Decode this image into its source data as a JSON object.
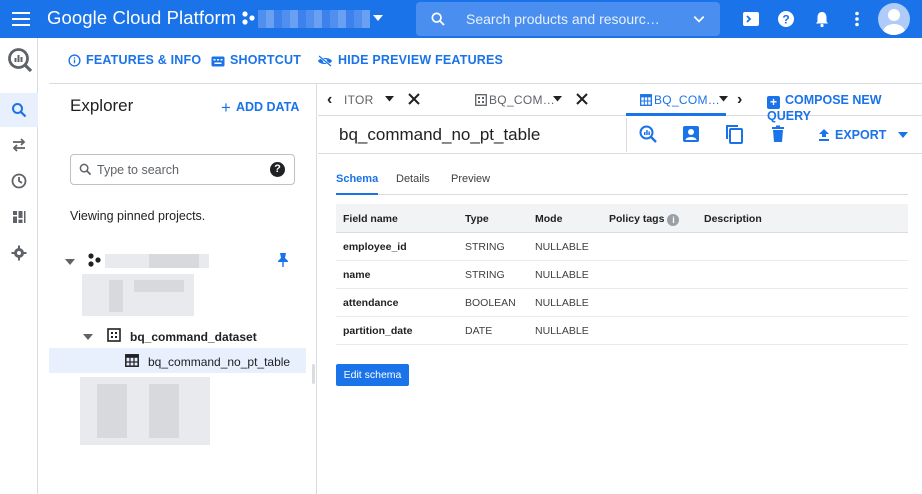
{
  "topbar": {
    "brand": "Google Cloud Platform",
    "search_placeholder": "Search products and resourc…"
  },
  "feature_bar": {
    "features": "FEATURES & INFO",
    "shortcut": "SHORTCUT",
    "hide_preview": "HIDE PREVIEW FEATURES"
  },
  "explorer": {
    "title": "Explorer",
    "add_data": "ADD DATA",
    "search_placeholder": "Type to search",
    "pinned_text": "Viewing pinned projects.",
    "dataset": "bq_command_dataset",
    "table": "bq_command_no_pt_table"
  },
  "tabs": {
    "tab1": "ITOR",
    "tab2": "BQ_COM…",
    "tab3": "BQ_COM…",
    "compose": "COMPOSE NEW QUERY"
  },
  "table_header": {
    "name": "bq_command_no_pt_table",
    "export": "EXPORT"
  },
  "subtabs": [
    "Schema",
    "Details",
    "Preview"
  ],
  "schema": {
    "headers": [
      "Field name",
      "Type",
      "Mode",
      "Policy tags",
      "Description"
    ],
    "rows": [
      {
        "field": "employee_id",
        "type": "STRING",
        "mode": "NULLABLE"
      },
      {
        "field": "name",
        "type": "STRING",
        "mode": "NULLABLE"
      },
      {
        "field": "attendance",
        "type": "BOOLEAN",
        "mode": "NULLABLE"
      },
      {
        "field": "partition_date",
        "type": "DATE",
        "mode": "NULLABLE"
      }
    ],
    "edit_button": "Edit schema"
  },
  "colors": {
    "brand_blue": "#1a73e8",
    "selected_row": "#e8f0fe"
  }
}
